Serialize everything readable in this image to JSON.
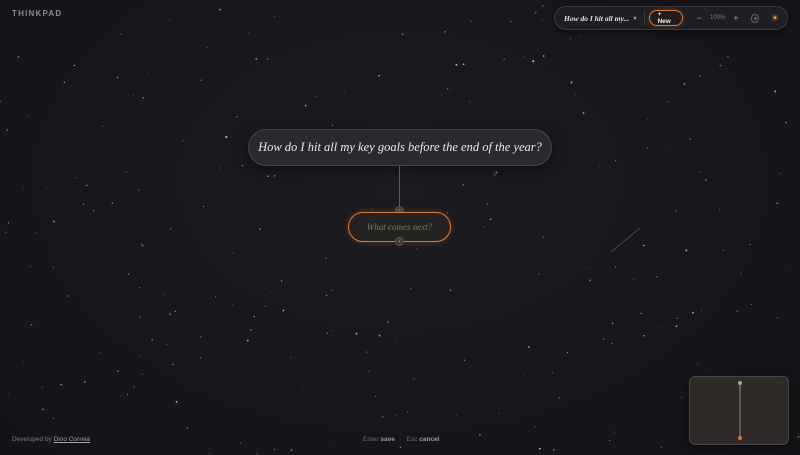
{
  "brand": {
    "name": "THINKPAD"
  },
  "toolbar": {
    "map_title": "How do I hit all my...",
    "caret": "▾",
    "new_label": "+ New",
    "zoom_out": "−",
    "zoom_level": "100%",
    "zoom_in": "+",
    "theme_icon": "☀"
  },
  "canvas": {
    "root_node": "How do I hit all my key goals before the end of the year?",
    "child_node_placeholder": "What comes next?",
    "child_node_value": "",
    "handle_top": "×",
    "handle_bottom": "+"
  },
  "footer": {
    "credit_prefix": "Developed by",
    "credit_author": "Dino Correia",
    "hint_enter_key": "Enter",
    "hint_enter_action": "save",
    "hint_sep": "·",
    "hint_esc_key": "Esc",
    "hint_esc_action": "cancel"
  },
  "colors": {
    "accent": "#d9792f",
    "background": "#17161a",
    "node": "#2a292e",
    "theme_icon": "#f1b43c"
  },
  "icons": {
    "caret": "chevron-down-icon",
    "fit": "fit-view-icon",
    "theme": "sun-icon"
  }
}
